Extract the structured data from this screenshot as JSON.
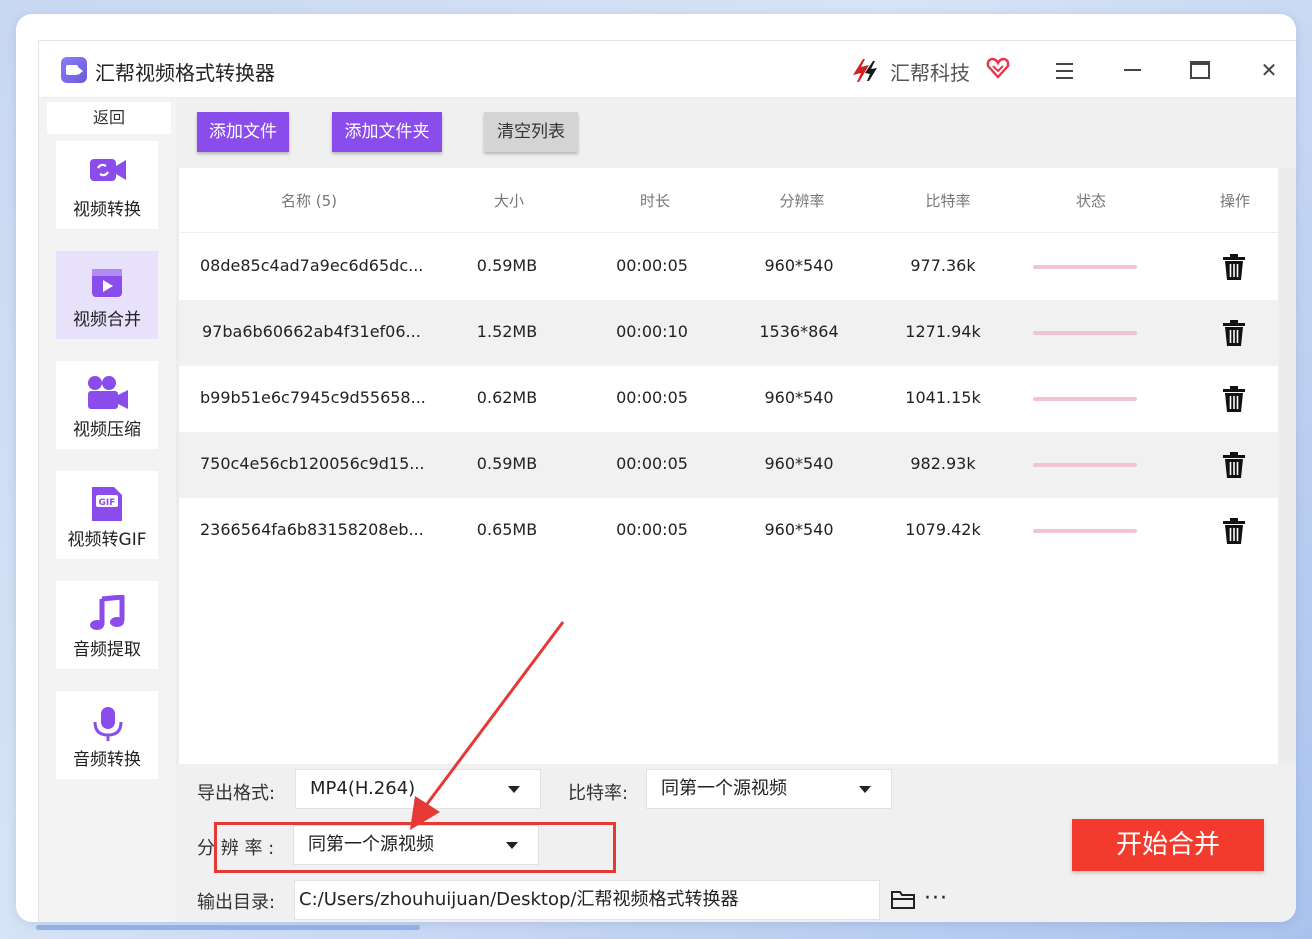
{
  "app": {
    "title": "汇帮视频格式转换器",
    "brand": "汇帮科技"
  },
  "sidebar": {
    "back": "返回",
    "items": [
      {
        "label": "视频转换",
        "icon": "video-convert-icon"
      },
      {
        "label": "视频合并",
        "icon": "video-merge-icon",
        "active": true
      },
      {
        "label": "视频压缩",
        "icon": "video-compress-icon"
      },
      {
        "label": "视频转GIF",
        "icon": "gif-icon"
      },
      {
        "label": "音频提取",
        "icon": "music-note-icon"
      },
      {
        "label": "音频转换",
        "icon": "microphone-icon"
      }
    ]
  },
  "toolbar": {
    "add_file": "添加文件",
    "add_folder": "添加文件夹",
    "clear_list": "清空列表"
  },
  "table": {
    "headers": [
      "名称 (5)",
      "大小",
      "时长",
      "分辨率",
      "比特率",
      "状态",
      "操作"
    ],
    "rows": [
      {
        "name": "08de85c4ad7a9ec6d65dc...",
        "size": "0.59MB",
        "duration": "00:00:05",
        "resolution": "960*540",
        "bitrate": "977.36k"
      },
      {
        "name": "97ba6b60662ab4f31ef06...",
        "size": "1.52MB",
        "duration": "00:00:10",
        "resolution": "1536*864",
        "bitrate": "1271.94k"
      },
      {
        "name": "b99b51e6c7945c9d55658...",
        "size": "0.62MB",
        "duration": "00:00:05",
        "resolution": "960*540",
        "bitrate": "1041.15k"
      },
      {
        "name": "750c4e56cb120056c9d15...",
        "size": "0.59MB",
        "duration": "00:00:05",
        "resolution": "960*540",
        "bitrate": "982.93k"
      },
      {
        "name": "2366564fa6b83158208eb...",
        "size": "0.65MB",
        "duration": "00:00:05",
        "resolution": "960*540",
        "bitrate": "1079.42k"
      }
    ]
  },
  "settings": {
    "format_label": "导出格式:",
    "format_value": "MP4(H.264)",
    "bitrate_label": "比特率:",
    "bitrate_value": "同第一个源视频",
    "resolution_label": "分 辨 率 :",
    "resolution_value": "同第一个源视频",
    "output_label": "输出目录:",
    "output_path": "C:/Users/zhouhuijuan/Desktop/汇帮视频格式转换器",
    "more": "···",
    "start": "开始合并"
  },
  "colors": {
    "accent": "#8a4dec",
    "start": "#f23b2d",
    "highlight": "#e53935"
  }
}
